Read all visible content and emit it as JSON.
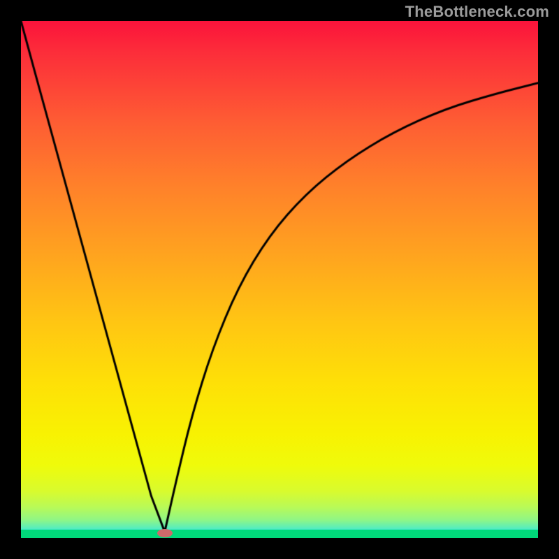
{
  "watermark": "TheBottleneck.com",
  "colors": {
    "frame": "#000000",
    "curve": "#000000",
    "marker": "#cf6a6a",
    "gradient_top": "#fb133b",
    "gradient_bottom": "#00d4ff",
    "green_strip": "#00d97a"
  },
  "chart_data": {
    "type": "line",
    "title": "",
    "xlabel": "",
    "ylabel": "",
    "xlim": [
      0,
      1
    ],
    "ylim": [
      0,
      1
    ],
    "note": "No axis ticks or numeric labels are rendered; values below are estimated from pixel positions on a normalized 0-1 unit square (origin bottom-left).",
    "series": [
      {
        "name": "left-branch",
        "x": [
          0.0,
          0.028,
          0.056,
          0.084,
          0.112,
          0.14,
          0.168,
          0.196,
          0.224,
          0.252,
          0.278
        ],
        "y": [
          1.0,
          0.897,
          0.795,
          0.693,
          0.591,
          0.489,
          0.387,
          0.285,
          0.183,
          0.081,
          0.012
        ]
      },
      {
        "name": "right-branch",
        "x": [
          0.278,
          0.3,
          0.33,
          0.37,
          0.42,
          0.48,
          0.55,
          0.63,
          0.72,
          0.82,
          0.92,
          1.0
        ],
        "y": [
          0.012,
          0.11,
          0.235,
          0.365,
          0.485,
          0.585,
          0.665,
          0.73,
          0.785,
          0.83,
          0.86,
          0.88
        ]
      }
    ],
    "marker": {
      "x": 0.278,
      "y": 0.01
    },
    "background": "vertical rainbow gradient red→yellow→green→cyan representing severity, green strip at bottom"
  }
}
